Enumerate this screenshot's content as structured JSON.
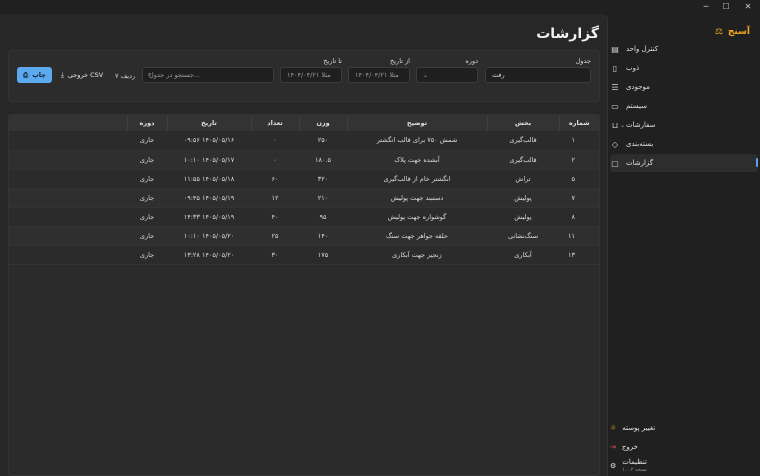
{
  "window": {
    "minimize": "─",
    "maximize": "☐",
    "close": "✕"
  },
  "brand": {
    "name": "آسنج"
  },
  "sidebar": {
    "items": [
      {
        "label": "کنترل واحد",
        "icon": "clipboard-icon"
      },
      {
        "label": "ذوب",
        "icon": "phone-icon"
      },
      {
        "label": "موجودی",
        "icon": "list-icon"
      },
      {
        "label": "سیستم",
        "icon": "monitor-icon"
      },
      {
        "label": "سفارشات",
        "icon": "cart-icon"
      },
      {
        "label": "بسته‌بندی",
        "icon": "tag-icon"
      },
      {
        "label": "گزارشات",
        "icon": "document-icon"
      }
    ],
    "bottom": {
      "theme": "تغییر پوسته",
      "logout": "خروج",
      "settings": "تنظیمات",
      "version": "نسخه ۱.۰.۲"
    }
  },
  "page": {
    "title": "گزارشات"
  },
  "filters": {
    "table_label": "جدول",
    "table_value": "رفت",
    "period_label": "دوره",
    "period_value": "",
    "from_label": "از تاریخ",
    "from_placeholder": "مثلا ۱۴۰۴/۰۴/۲۱",
    "to_label": "تا تاریخ",
    "to_placeholder": "مثلا ۱۴۰۴/۰۴/۲۱",
    "search_placeholder": "جستجو در جدول...",
    "rows_count": "۷ ردیف",
    "csv_label": "خروجی CSV",
    "print_label": "چاپ"
  },
  "table": {
    "headers": [
      "شماره",
      "بخش",
      "توضیح",
      "وزن",
      "تعداد",
      "تاریخ",
      "دوره"
    ],
    "rows": [
      [
        "۱",
        "قالب‌گیری",
        "شمش ۷۵۰ برای قالب انگشتر",
        "۲۵۰",
        "۰",
        "۱۴۰۵/۰۵/۱۶ ۰۹:۵۶",
        "جاری"
      ],
      [
        "۲",
        "قالب‌گیری",
        "آبشده جهت پلاک",
        "۱۸۰.۵",
        "۰",
        "۱۴۰۵/۰۵/۱۷ ۱۰:۱۰",
        "جاری"
      ],
      [
        "۵",
        "تراش",
        "انگشتر خام از قالب‌گیری",
        "۳۲۰",
        "۶۰",
        "۱۴۰۵/۰۵/۱۸ ۱۱:۵۵",
        "جاری"
      ],
      [
        "۷",
        "پولیش",
        "دستبند جهت پولیش",
        "۲۱۰",
        "۱۲",
        "۱۴۰۵/۰۵/۱۹ ۰۹:۴۵",
        "جاری"
      ],
      [
        "۸",
        "پولیش",
        "گوشواره جهت پولیش",
        "۹۵",
        "۴۰",
        "۱۴۰۵/۰۵/۱۹ ۱۴:۳۳",
        "جاری"
      ],
      [
        "۱۱",
        "سنگ‌نشانی",
        "حلقه جواهر جهت سنگ",
        "۱۴۰",
        "۲۵",
        "۱۴۰۵/۰۵/۲۰ ۱۰:۱۰",
        "جاری"
      ],
      [
        "۱۳",
        "آبکاری",
        "زنجیر جهت آبکاری",
        "۱۷۵",
        "۳۰",
        "۱۴۰۵/۰۵/۲۰ ۱۳:۲۸",
        "جاری"
      ]
    ]
  },
  "colors": {
    "accent": "#f0a81f",
    "primary": "#5ca9ef",
    "background": "#202020"
  }
}
